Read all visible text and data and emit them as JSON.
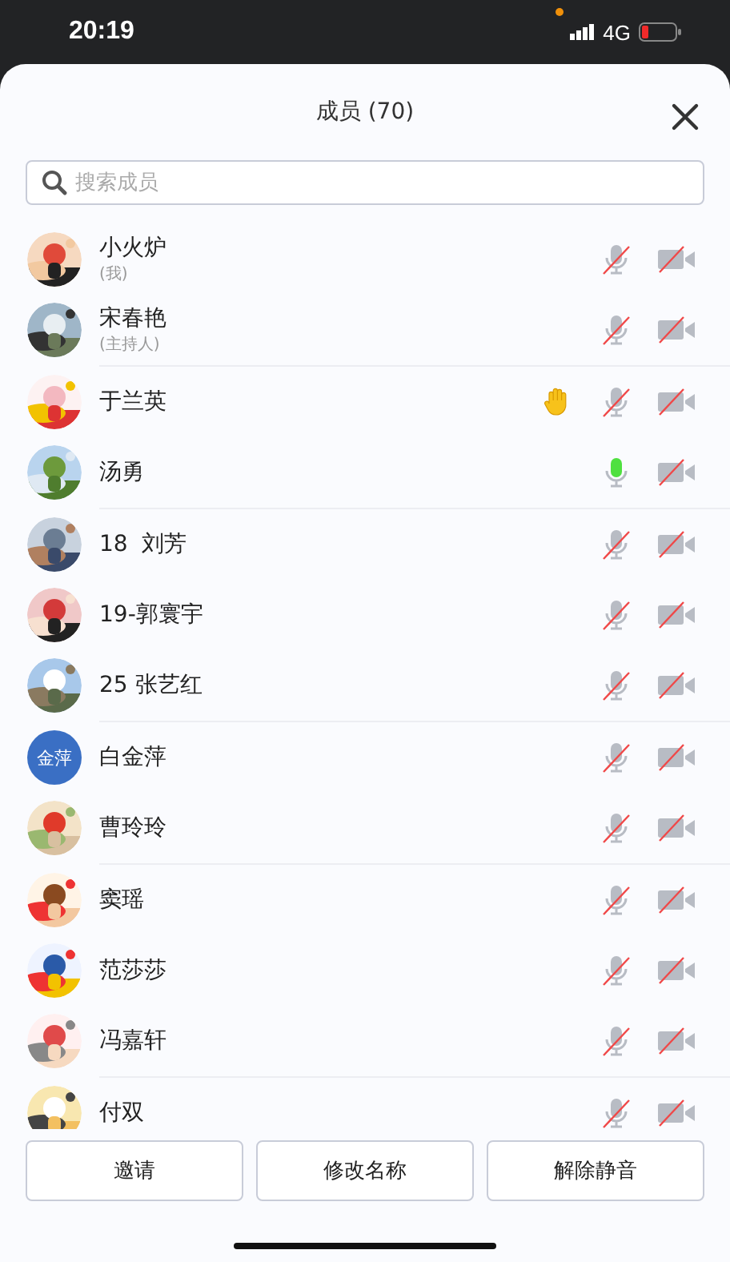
{
  "status_bar": {
    "time": "20:19",
    "network": "4G"
  },
  "header": {
    "title": "成员 (70)"
  },
  "search": {
    "placeholder": "搜索成员"
  },
  "member_groups": [
    {
      "members": [
        {
          "name": "小火炉",
          "note": "(我)",
          "hand_raised": false,
          "mic_on": false,
          "camera_on": false
        },
        {
          "name": "宋春艳",
          "note": "(主持人)",
          "hand_raised": false,
          "mic_on": false,
          "camera_on": false
        }
      ]
    },
    {
      "members": [
        {
          "name": "于兰英",
          "hand_raised": true,
          "mic_on": false,
          "camera_on": false
        },
        {
          "name": "汤勇",
          "hand_raised": false,
          "mic_on": true,
          "camera_on": false
        }
      ]
    },
    {
      "members": [
        {
          "name": "18  刘芳",
          "hand_raised": false,
          "mic_on": false,
          "camera_on": false
        },
        {
          "name": "19-郭寰宇",
          "hand_raised": false,
          "mic_on": false,
          "camera_on": false
        },
        {
          "name": "25 张艺红",
          "hand_raised": false,
          "mic_on": false,
          "camera_on": false
        }
      ]
    },
    {
      "members": [
        {
          "name": "白金萍",
          "avatar": {
            "kind": "text",
            "text": "金萍"
          },
          "hand_raised": false,
          "mic_on": false,
          "camera_on": false
        },
        {
          "name": "曹玲玲",
          "hand_raised": false,
          "mic_on": false,
          "camera_on": false
        }
      ]
    },
    {
      "members": [
        {
          "name": "窦瑶",
          "hand_raised": false,
          "mic_on": false,
          "camera_on": false
        },
        {
          "name": "范莎莎",
          "hand_raised": false,
          "mic_on": false,
          "camera_on": false
        },
        {
          "name": "冯嘉轩",
          "hand_raised": false,
          "mic_on": false,
          "camera_on": false
        }
      ]
    },
    {
      "members": [
        {
          "name": "付双",
          "hand_raised": false,
          "mic_on": false,
          "camera_on": false
        }
      ]
    }
  ],
  "buttons": [
    "邀请",
    "修改名称",
    "解除静音"
  ]
}
